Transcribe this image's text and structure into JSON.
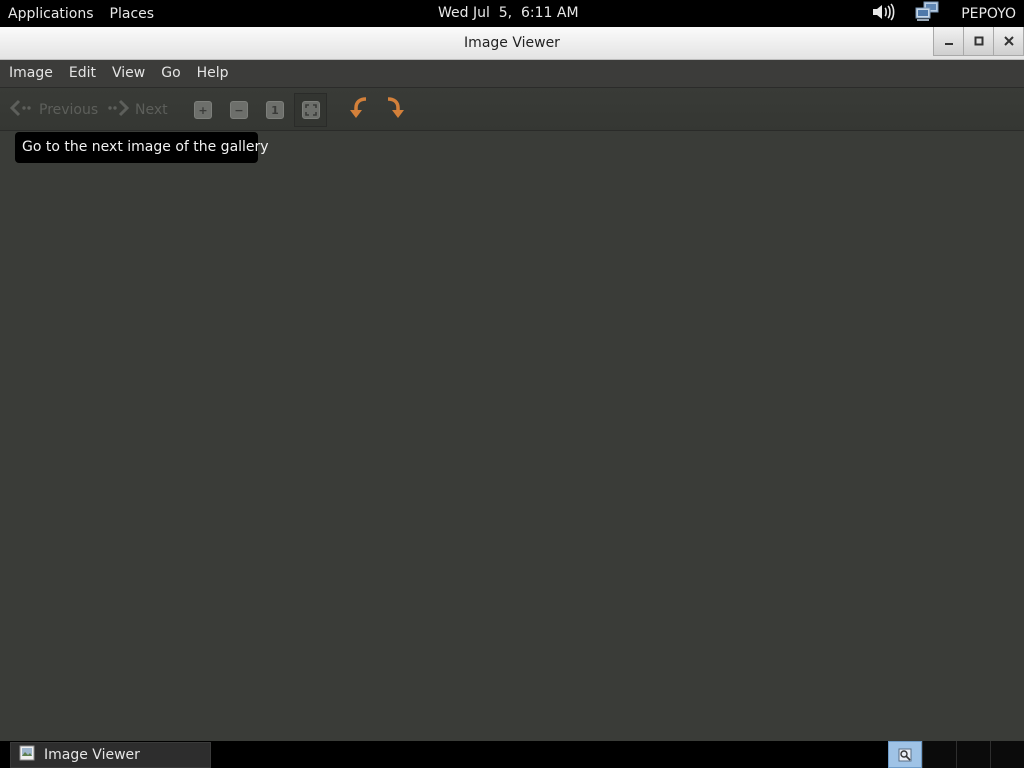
{
  "top_panel": {
    "applications": "Applications",
    "places": "Places",
    "clock": "Wed Jul  5,  6:11 AM",
    "user": "PEPOYO",
    "icons": [
      "volume-icon",
      "network-icon"
    ]
  },
  "window": {
    "title": "Image Viewer",
    "buttons": [
      "minimize",
      "maximize",
      "close"
    ]
  },
  "menu": {
    "items": [
      "Image",
      "Edit",
      "View",
      "Go",
      "Help"
    ]
  },
  "toolbar": {
    "previous_label": "Previous",
    "next_label": "Next",
    "icons": [
      "zoom-in-icon",
      "zoom-out-icon",
      "normal-size-icon",
      "best-fit-icon",
      "rotate-left-icon",
      "rotate-right-icon"
    ]
  },
  "tooltip": {
    "text": "Go to the next image of the gallery"
  },
  "taskbar": {
    "task_label": "Image Viewer"
  },
  "colors": {
    "panel": "#000000",
    "content_bg": "#3a3c38",
    "rotate_accent": "#d3803a",
    "workspace_active": "#9fc3e6"
  }
}
